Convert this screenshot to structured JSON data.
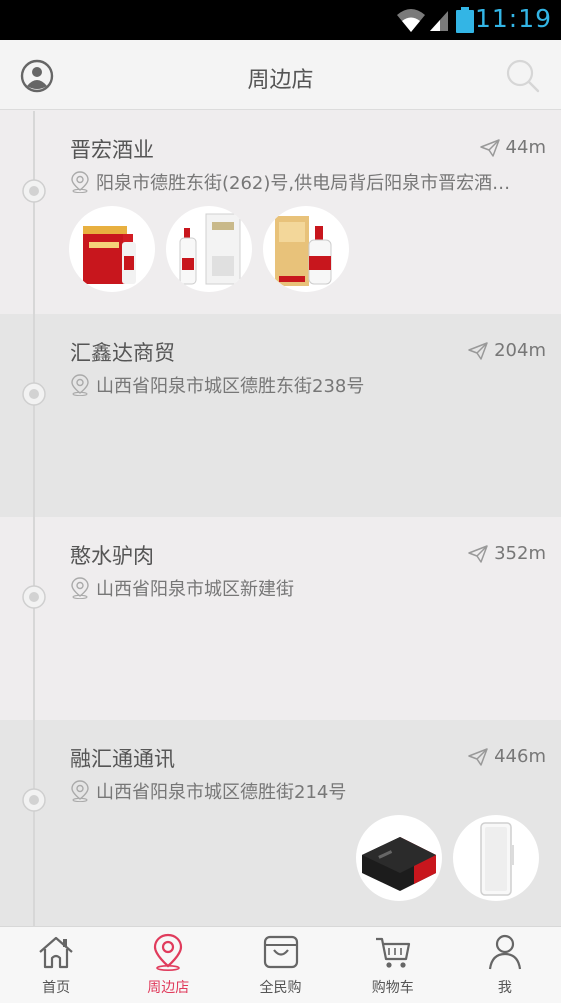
{
  "status_bar": {
    "time": "11:19",
    "accent": "#33b5e5"
  },
  "header": {
    "title": "周边店",
    "left_icon": "user-icon",
    "right_icon": "search-icon"
  },
  "stores": [
    {
      "name": "晋宏酒业",
      "distance": "44m",
      "address": "阳泉市德胜东街(262)号,供电局背后阳泉市晋宏酒…",
      "thumbnails": [
        "red-baijiu-gift-box",
        "white-wuliangye-box",
        "gold-moutai-box"
      ]
    },
    {
      "name": "汇鑫达商贸",
      "distance": "204m",
      "address": "山西省阳泉市城区德胜东街238号",
      "thumbnails": []
    },
    {
      "name": "憨水驴肉",
      "distance": "352m",
      "address": "山西省阳泉市城区新建街",
      "thumbnails": []
    },
    {
      "name": "融汇通通讯",
      "distance": "446m",
      "address": "山西省阳泉市城区德胜街214号",
      "thumbnails": [
        "black-red-router",
        "white-power-bank"
      ]
    }
  ],
  "tabs": [
    {
      "label": "首页",
      "icon": "home-icon",
      "active": false
    },
    {
      "label": "周边店",
      "icon": "location-pin-icon",
      "active": true
    },
    {
      "label": "全民购",
      "icon": "shopping-bag-icon",
      "active": false
    },
    {
      "label": "购物车",
      "icon": "cart-icon",
      "active": false
    },
    {
      "label": "我",
      "icon": "person-icon",
      "active": false
    }
  ],
  "colors": {
    "active_tab": "#e03b5c",
    "row_light": "#efedee",
    "row_dark": "#e5e5e5"
  }
}
